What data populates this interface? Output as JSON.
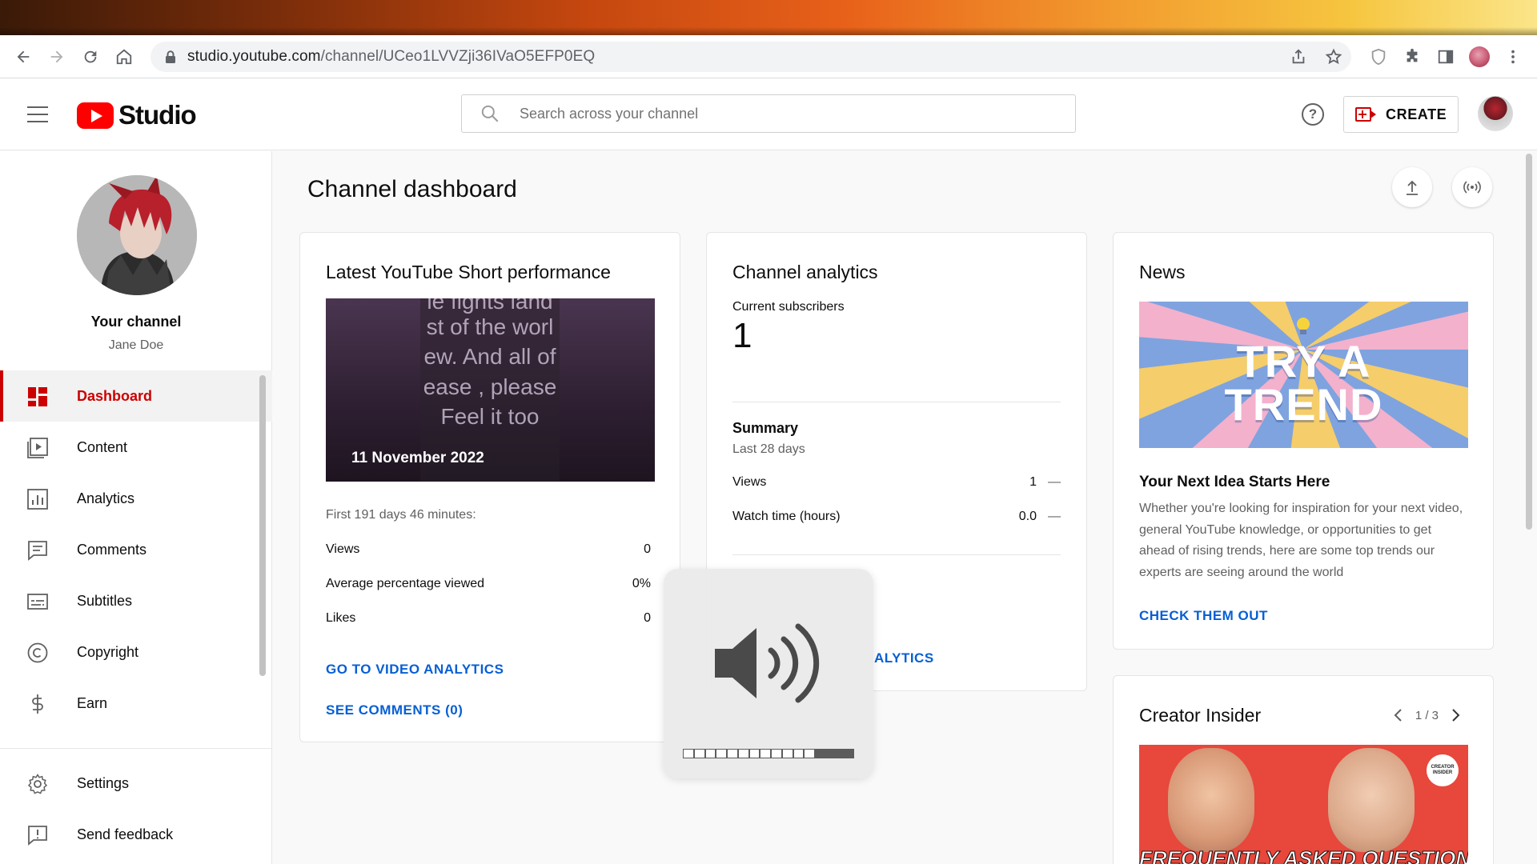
{
  "browser": {
    "url_host": "studio.youtube.com",
    "url_path": "/channel/UCeo1LVVZji36IVaO5EFP0EQ"
  },
  "header": {
    "logo_text": "Studio",
    "search_placeholder": "Search across your channel",
    "help_label": "?",
    "create_label": "CREATE"
  },
  "sidebar": {
    "channel_label": "Your channel",
    "channel_name": "Jane Doe",
    "items": [
      {
        "label": "Dashboard",
        "icon": "dashboard-icon",
        "active": true
      },
      {
        "label": "Content",
        "icon": "content-icon"
      },
      {
        "label": "Analytics",
        "icon": "analytics-icon"
      },
      {
        "label": "Comments",
        "icon": "comments-icon"
      },
      {
        "label": "Subtitles",
        "icon": "subtitles-icon"
      },
      {
        "label": "Copyright",
        "icon": "copyright-icon"
      },
      {
        "label": "Earn",
        "icon": "earn-icon"
      }
    ],
    "bottom_items": [
      {
        "label": "Settings",
        "icon": "settings-icon"
      },
      {
        "label": "Send feedback",
        "icon": "feedback-icon"
      }
    ]
  },
  "main": {
    "title": "Channel dashboard",
    "short_card": {
      "title": "Latest YouTube Short performance",
      "thumbnail_lines": [
        "le fights land",
        "st of the worl",
        "ew. And all of",
        "ease , please",
        "Feel it too"
      ],
      "thumbnail_date": "11 November 2022",
      "period": "First 191 days 46 minutes:",
      "stats": [
        {
          "label": "Views",
          "value": "0"
        },
        {
          "label": "Average percentage viewed",
          "value": "0%"
        },
        {
          "label": "Likes",
          "value": "0"
        }
      ],
      "link_analytics": "GO TO VIDEO ANALYTICS",
      "link_comments": "SEE COMMENTS (0)"
    },
    "analytics_card": {
      "title": "Channel analytics",
      "subs_label": "Current subscribers",
      "subs_value": "1",
      "summary_title": "Summary",
      "summary_period": "Last 28 days",
      "rows": [
        {
          "label": "Views",
          "value": "1",
          "trend": "—"
        },
        {
          "label": "Watch time (hours)",
          "value": "0.0",
          "trend": "—"
        }
      ],
      "link_partial": "ALYTICS"
    },
    "news_card": {
      "title": "News",
      "image_line1": "TRY A",
      "image_line2": "TREND",
      "headline": "Your Next Idea Starts Here",
      "body": "Whether you're looking for inspiration for your next video, general YouTube knowledge, or opportunities to get ahead of rising trends, here are some top trends our experts are seeing around the world",
      "link": "CHECK THEM OUT"
    },
    "creator_card": {
      "title": "Creator Insider",
      "pager": "1 / 3",
      "badge": "CREATOR INSIDER",
      "caption": "FREQUENTLY ASKED QUESTIONS"
    }
  },
  "volume_overlay": {
    "level": 0.78
  },
  "colors": {
    "brand_red": "#ff0000",
    "accent_red": "#cc0000",
    "link_blue": "#065fd4"
  }
}
